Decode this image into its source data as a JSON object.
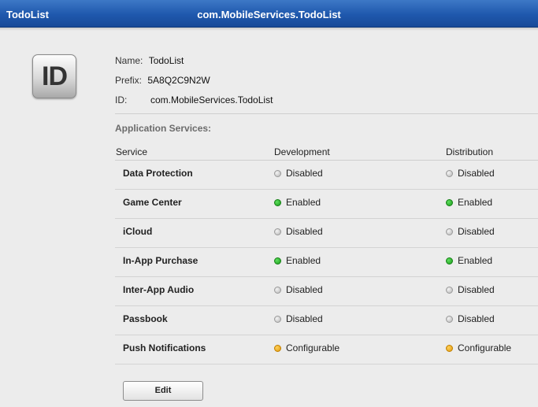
{
  "titlebar": {
    "app_title": "TodoList",
    "center_title": "com.MobileServices.TodoList"
  },
  "badge": {
    "text": "ID"
  },
  "meta": {
    "name_label": "Name:",
    "name_value": "TodoList",
    "prefix_label": "Prefix:",
    "prefix_value": "5A8Q2C9N2W",
    "id_label": "ID:",
    "id_value": "com.MobileServices.TodoList"
  },
  "services": {
    "section_title": "Application Services:",
    "headers": {
      "service": "Service",
      "development": "Development",
      "distribution": "Distribution"
    },
    "rows": [
      {
        "name": "Data Protection",
        "development": "Disabled",
        "distribution": "Disabled",
        "dev_status": "gray",
        "dist_status": "gray"
      },
      {
        "name": "Game Center",
        "development": "Enabled",
        "distribution": "Enabled",
        "dev_status": "green",
        "dist_status": "green"
      },
      {
        "name": "iCloud",
        "development": "Disabled",
        "distribution": "Disabled",
        "dev_status": "gray",
        "dist_status": "gray"
      },
      {
        "name": "In-App Purchase",
        "development": "Enabled",
        "distribution": "Enabled",
        "dev_status": "green",
        "dist_status": "green"
      },
      {
        "name": "Inter-App Audio",
        "development": "Disabled",
        "distribution": "Disabled",
        "dev_status": "gray",
        "dist_status": "gray"
      },
      {
        "name": "Passbook",
        "development": "Disabled",
        "distribution": "Disabled",
        "dev_status": "gray",
        "dist_status": "gray"
      },
      {
        "name": "Push Notifications",
        "development": "Configurable",
        "distribution": "Configurable",
        "dev_status": "orange",
        "dist_status": "orange"
      }
    ]
  },
  "actions": {
    "edit_label": "Edit"
  },
  "colors": {
    "titlebar": "#2a62b8",
    "enabled": "#1fae1f",
    "disabled": "#b5b5b5",
    "configurable": "#f0a81a"
  }
}
